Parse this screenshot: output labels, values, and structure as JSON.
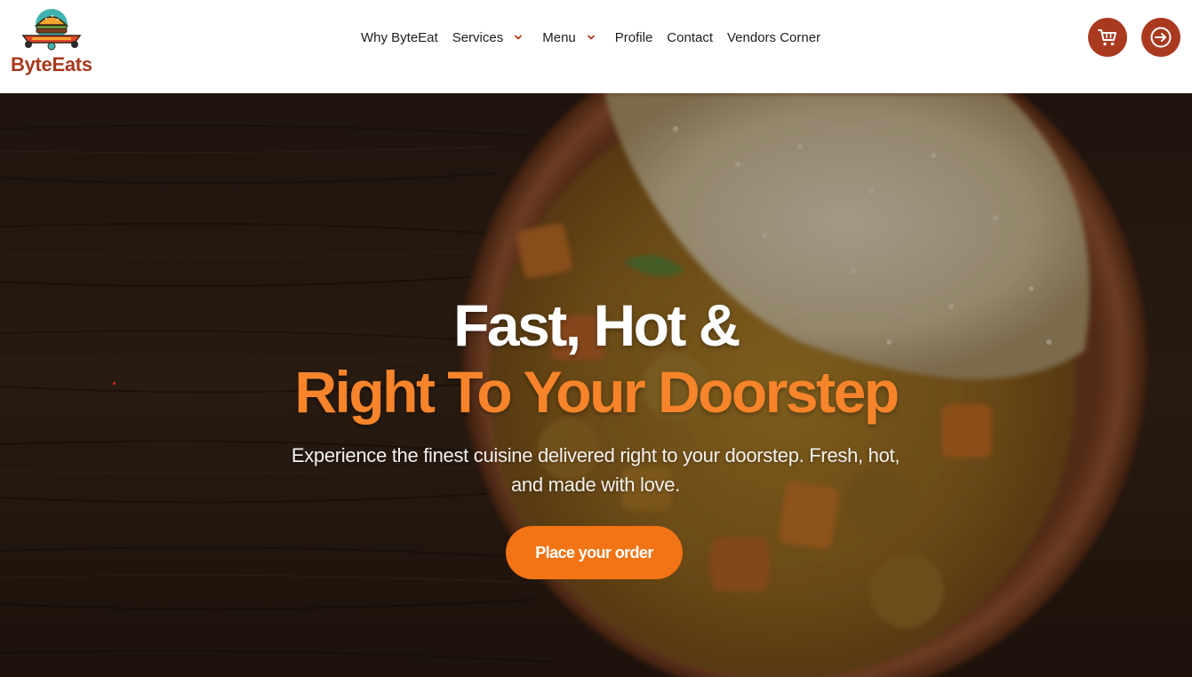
{
  "brand": {
    "name": "ByteEats",
    "color": "#a73a1d"
  },
  "nav": {
    "items": [
      {
        "label": "Why ByteEat",
        "has_dropdown": false
      },
      {
        "label": "Services",
        "has_dropdown": true
      },
      {
        "label": "Menu",
        "has_dropdown": true
      },
      {
        "label": "Profile",
        "has_dropdown": false
      },
      {
        "label": "Contact",
        "has_dropdown": false
      },
      {
        "label": "Vendors Corner",
        "has_dropdown": false
      }
    ],
    "caret_color": "#b5361b"
  },
  "header_actions": {
    "cart_icon": "cart-icon",
    "login_icon": "login-arrow-icon",
    "button_color": "#a93a20"
  },
  "hero": {
    "title_line1": "Fast, Hot &",
    "title_line2": "Right To Your Doorstep",
    "subtitle": "Experience the finest cuisine delivered right to your doorstep. Fresh, hot, and made with love.",
    "cta_label": "Place your order",
    "accent_color": "#f7842a",
    "cta_color": "#f27415"
  }
}
